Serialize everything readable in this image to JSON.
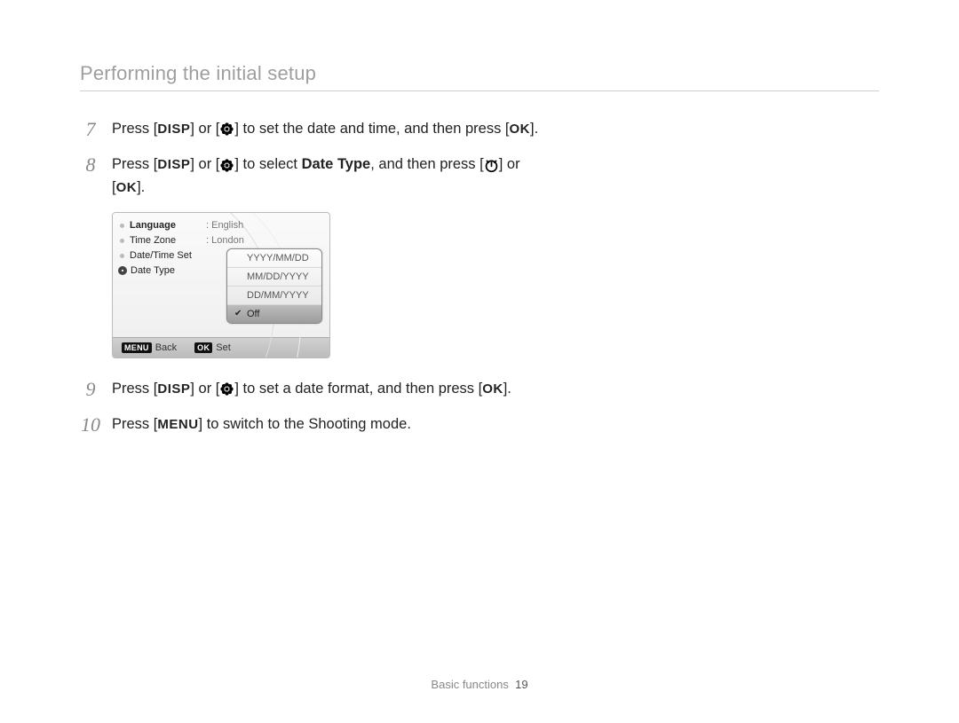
{
  "header": {
    "title": "Performing the initial setup"
  },
  "steps": {
    "s7": {
      "num": "7",
      "pre": "Press [",
      "disp": "DISP",
      "mid1": "] or [",
      "icon1": "flower-icon",
      "mid2": "] to set the date and time, and then press [",
      "ok": "OK",
      "post": "]."
    },
    "s8": {
      "num": "8",
      "pre": "Press [",
      "disp": "DISP",
      "mid1": "] or [",
      "icon1": "flower-icon",
      "mid2": "] to select ",
      "bold": "Date Type",
      "mid3": ", and then press [",
      "icon2": "timer-icon",
      "mid4": "] or [",
      "ok": "OK",
      "post": "]."
    },
    "s9": {
      "num": "9",
      "pre": "Press [",
      "disp": "DISP",
      "mid1": "] or [",
      "icon1": "flower-icon",
      "mid2": "] to set a date format, and then press [",
      "ok": "OK",
      "post": "]."
    },
    "s10": {
      "num": "10",
      "pre": "Press [",
      "menu": "MENU",
      "post": "] to switch to the Shooting mode."
    }
  },
  "camera": {
    "menu": [
      {
        "label": "Language",
        "bold": true,
        "value": ": English"
      },
      {
        "label": "Time Zone",
        "value": ": London"
      },
      {
        "label": "Date/Time Set",
        "value": ""
      },
      {
        "label": "Date Type",
        "value": "",
        "active": true
      }
    ],
    "dropdown": [
      {
        "text": "YYYY/MM/DD",
        "selected": false
      },
      {
        "text": "MM/DD/YYYY",
        "selected": false
      },
      {
        "text": "DD/MM/YYYY",
        "selected": false
      },
      {
        "text": "Off",
        "selected": true
      }
    ],
    "footer": {
      "back_btn": "MENU",
      "back_label": "Back",
      "set_btn": "OK",
      "set_label": "Set"
    }
  },
  "footer": {
    "section": "Basic functions",
    "page": "19"
  }
}
